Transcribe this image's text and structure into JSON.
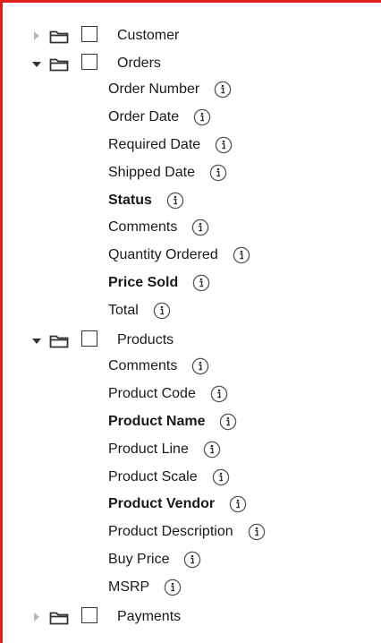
{
  "colors": {
    "frame_accent": "#e0201c",
    "caret_expanded": "#333333",
    "caret_collapsed": "#b8b8b8"
  },
  "tree": {
    "folders": [
      {
        "label": "Customer",
        "expanded": false,
        "fields": []
      },
      {
        "label": "Orders",
        "expanded": true,
        "fields": [
          {
            "label": "Order Number",
            "bold": false
          },
          {
            "label": "Order Date",
            "bold": false
          },
          {
            "label": "Required Date",
            "bold": false
          },
          {
            "label": "Shipped Date",
            "bold": false
          },
          {
            "label": "Status",
            "bold": true
          },
          {
            "label": "Comments",
            "bold": false
          },
          {
            "label": "Quantity Ordered",
            "bold": false
          },
          {
            "label": "Price Sold",
            "bold": true
          },
          {
            "label": "Total",
            "bold": false
          }
        ]
      },
      {
        "label": "Products",
        "expanded": true,
        "fields": [
          {
            "label": "Comments",
            "bold": false
          },
          {
            "label": "Product Code",
            "bold": false
          },
          {
            "label": "Product Name",
            "bold": true
          },
          {
            "label": "Product Line",
            "bold": false
          },
          {
            "label": "Product Scale",
            "bold": false
          },
          {
            "label": "Product Vendor",
            "bold": true
          },
          {
            "label": "Product Description",
            "bold": false
          },
          {
            "label": "Buy Price",
            "bold": false
          },
          {
            "label": "MSRP",
            "bold": false
          }
        ]
      },
      {
        "label": "Payments",
        "expanded": false,
        "fields": []
      }
    ]
  },
  "icons": {
    "folder": "folder-icon",
    "info": "info-icon",
    "expand": "caret-right-icon",
    "collapse": "caret-down-icon"
  }
}
